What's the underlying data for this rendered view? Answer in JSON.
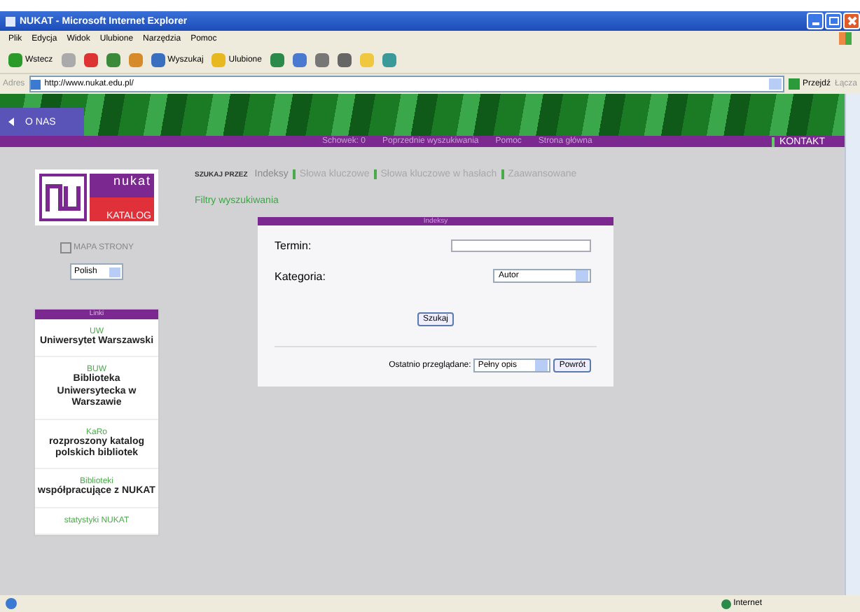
{
  "window": {
    "title": "NUKAT - Microsoft Internet Explorer"
  },
  "menu": [
    "Plik",
    "Edycja",
    "Widok",
    "Ulubione",
    "Narzędzia",
    "Pomoc"
  ],
  "toolbar": [
    {
      "kind": "back",
      "label": "Wstecz"
    },
    {
      "kind": "forward"
    },
    {
      "kind": "stop"
    },
    {
      "kind": "refresh"
    },
    {
      "kind": "home"
    },
    {
      "kind": "search",
      "label": "Wyszukaj"
    },
    {
      "kind": "favorites",
      "label": "Ulubione"
    },
    {
      "kind": "history"
    },
    {
      "kind": "mail"
    },
    {
      "kind": "print"
    },
    {
      "kind": "edit"
    },
    {
      "kind": "folder"
    },
    {
      "kind": "messenger"
    }
  ],
  "address": {
    "label": "Adres",
    "value": "http://www.nukat.edu.pl/",
    "go": "Przejdź",
    "links": "Łącza"
  },
  "page": {
    "side_tab": "O NAS",
    "nav": [
      {
        "label": "Schowek: 0"
      },
      {
        "label": "Poprzednie wyszukiwania"
      },
      {
        "label": "Pomoc"
      },
      {
        "label": "Strona główna"
      }
    ],
    "contact": "KONTAKT",
    "logo": {
      "name": "nukat",
      "sub": "KATALOG"
    },
    "sitemap": "MAPA STRONY",
    "language": "Polish",
    "links_box": {
      "title": "Linki",
      "items": [
        {
          "tag": "UW",
          "text": "Uniwersytet Warszawski"
        },
        {
          "tag": "BUW",
          "text": "Biblioteka Uniwersytecka w Warszawie"
        },
        {
          "tag": "KaRo",
          "text": "rozproszony katalog polskich bibliotek"
        },
        {
          "tag": "Biblioteki",
          "text": "współpracujące z NUKAT"
        },
        {
          "tag": "statystyki NUKAT"
        }
      ]
    },
    "search_by": {
      "label": "SZUKAJ PRZEZ",
      "tabs": [
        {
          "label": "Indeksy",
          "selected": true
        },
        {
          "label": "Słowa kluczowe",
          "selected": false
        },
        {
          "label": "Słowa kluczowe w hasłach",
          "selected": false
        },
        {
          "label": "Zaawansowane",
          "selected": false
        }
      ]
    },
    "filters": "Filtry wyszukiwania",
    "form": {
      "title": "Indeksy",
      "term_label": "Termin:",
      "category_label": "Kategoria:",
      "category": "Autor",
      "search_button": "Szukaj",
      "recent_label": "Ostatnio przeglądane:",
      "recent": "Pełny opis",
      "back_button": "Powrót"
    }
  },
  "status_bar": {
    "zone": "Internet"
  }
}
